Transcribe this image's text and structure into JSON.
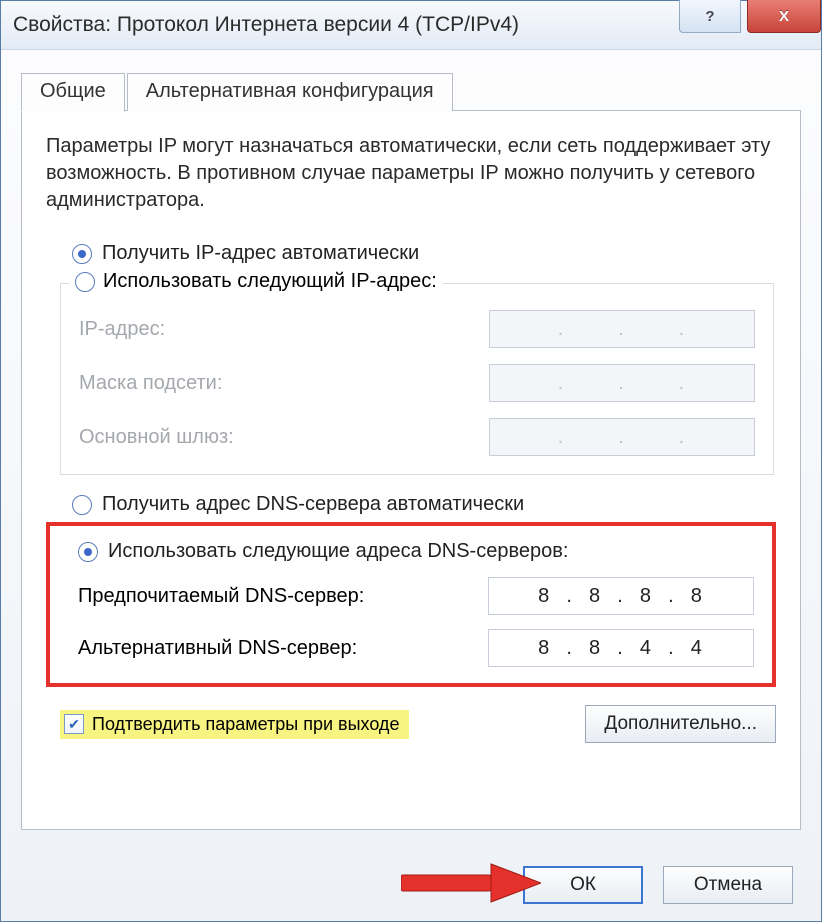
{
  "window": {
    "title": "Свойства: Протокол Интернета версии 4 (TCP/IPv4)"
  },
  "tabs": {
    "general": "Общие",
    "alternate": "Альтернативная конфигурация"
  },
  "description": "Параметры IP могут назначаться автоматически, если сеть поддерживает эту возможность. В противном случае параметры IP можно получить у сетевого администратора.",
  "ip": {
    "auto_label": "Получить IP-адрес автоматически",
    "manual_label": "Использовать следующий IP-адрес:",
    "fields": {
      "ip_label": "IP-адрес:",
      "ip_value": ".       .       .",
      "mask_label": "Маска подсети:",
      "mask_value": ".       .       .",
      "gateway_label": "Основной шлюз:",
      "gateway_value": ".       .       ."
    }
  },
  "dns": {
    "auto_label": "Получить адрес DNS-сервера автоматически",
    "manual_label": "Использовать следующие адреса DNS-серверов:",
    "preferred_label": "Предпочитаемый DNS-сервер:",
    "preferred_value": "8  .  8  .  8  .  8",
    "alternate_label": "Альтернативный DNS-сервер:",
    "alternate_value": "8  .  8  .  4  .  4"
  },
  "validate_label": "Подтвердить параметры при выходе",
  "buttons": {
    "advanced": "Дополнительно...",
    "ok": "ОК",
    "cancel": "Отмена"
  }
}
